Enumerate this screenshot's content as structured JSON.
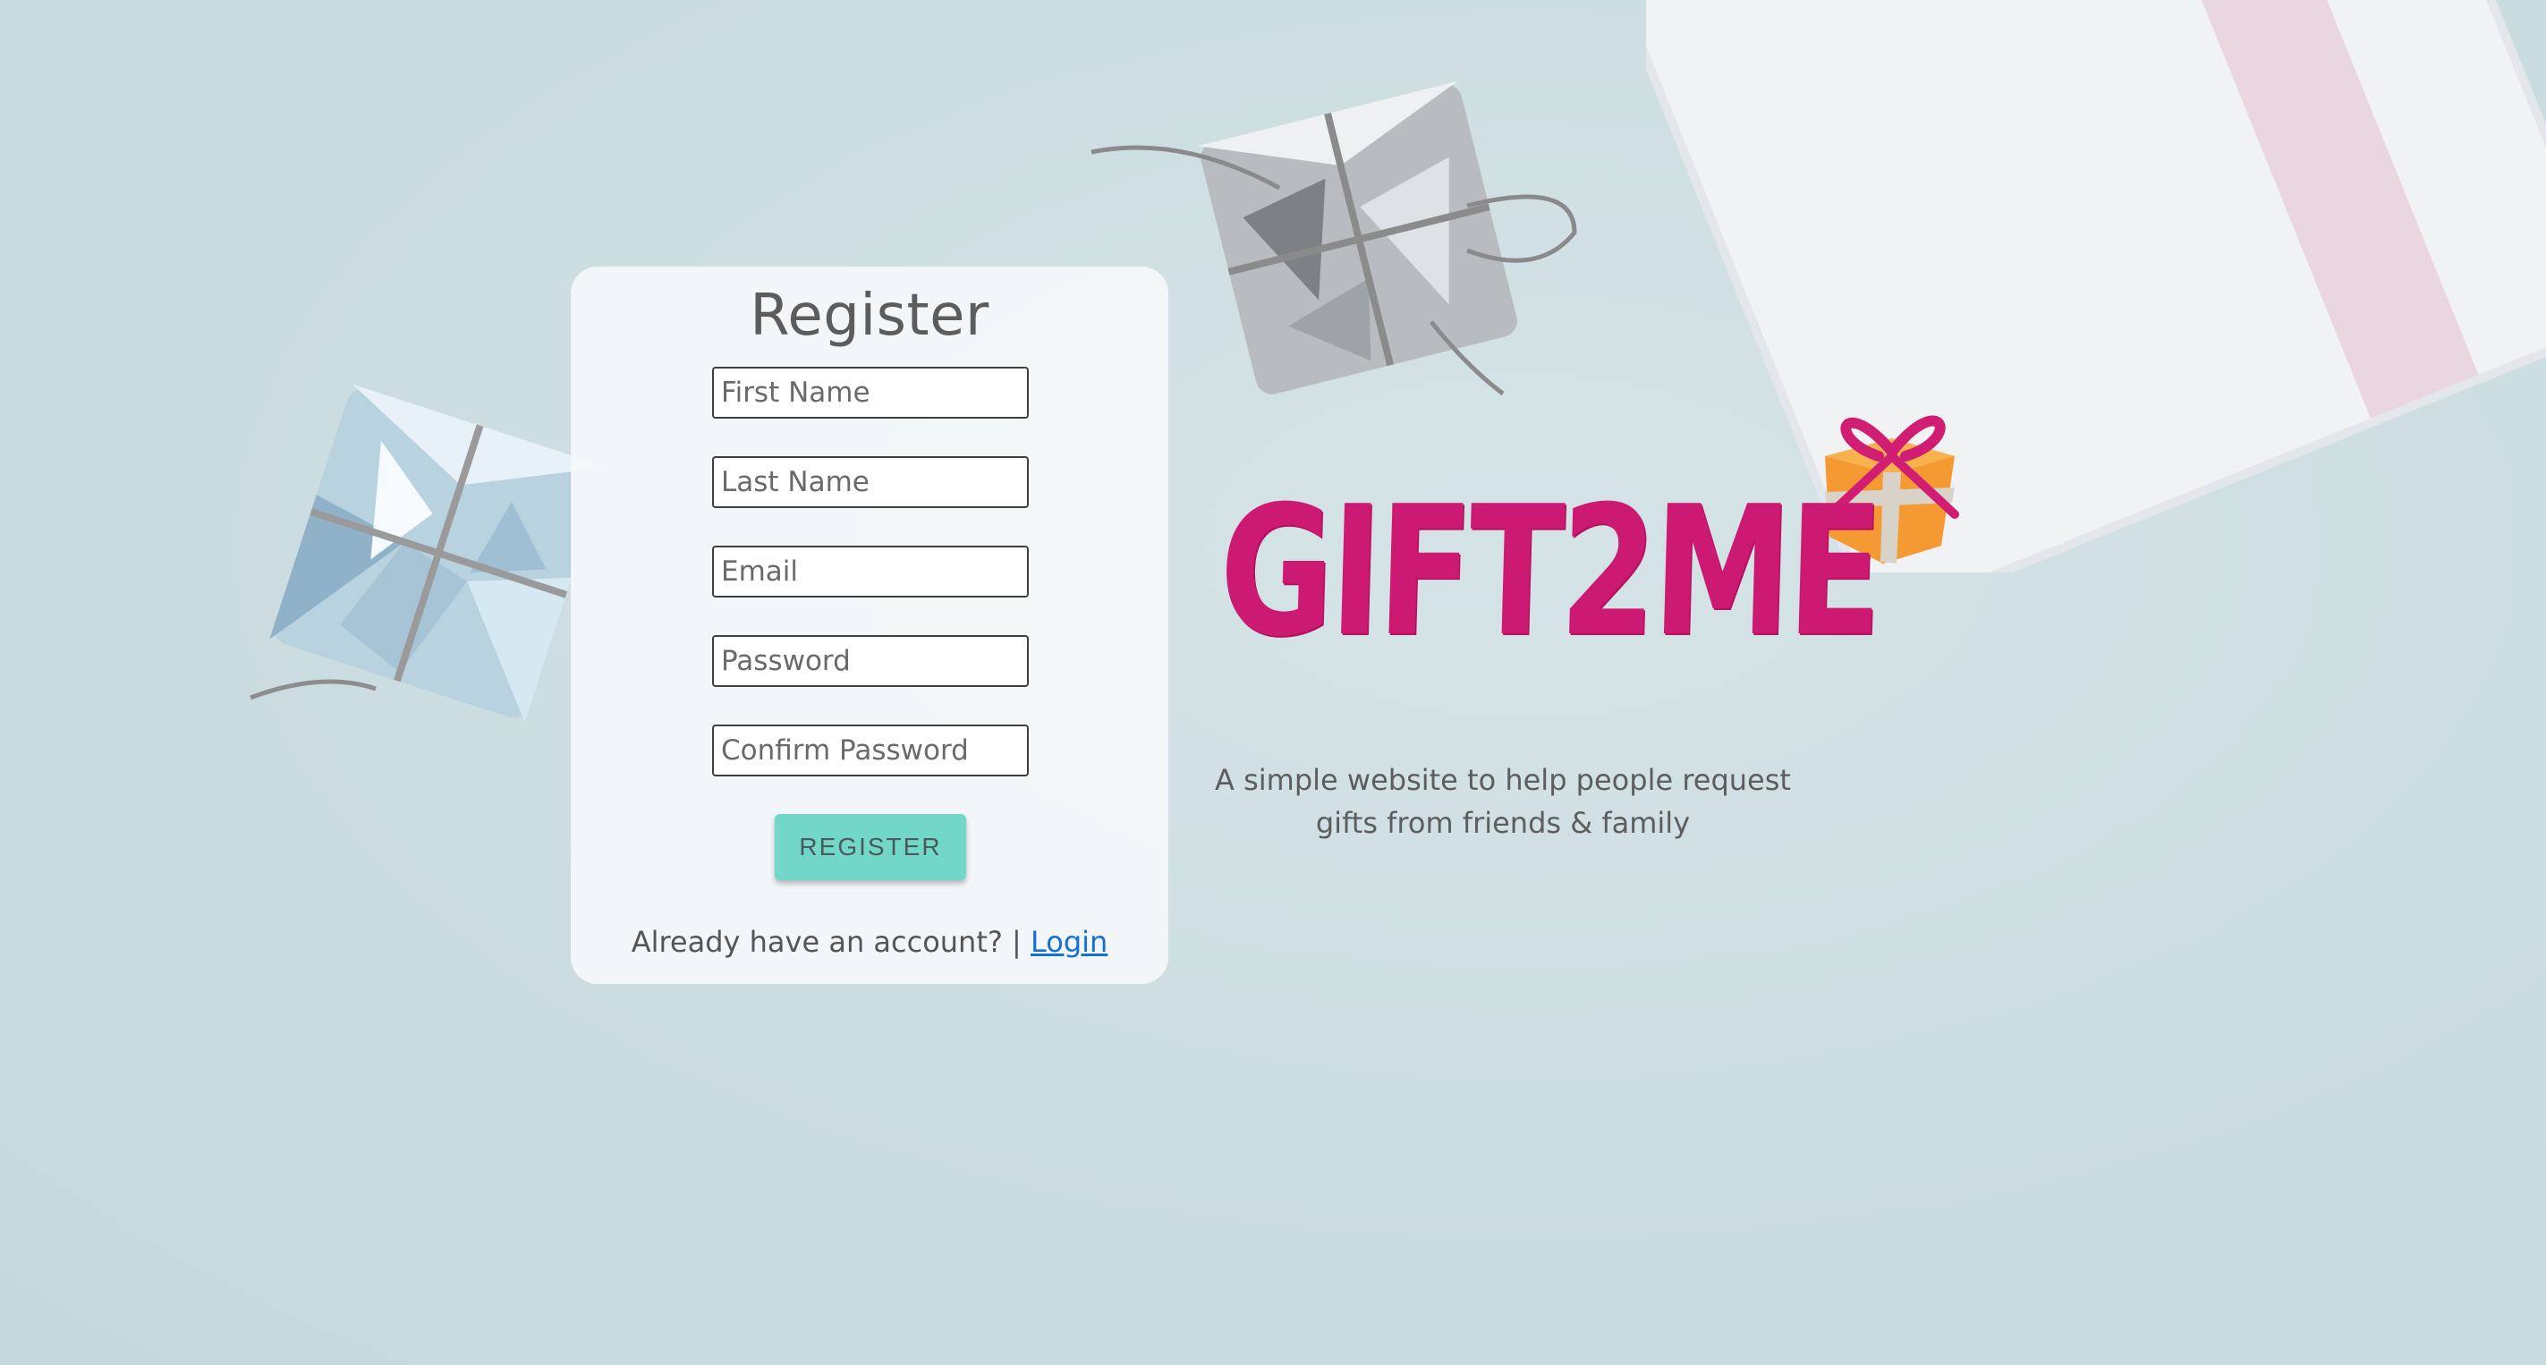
{
  "register": {
    "title": "Register",
    "first_name_placeholder": "First Name",
    "last_name_placeholder": "Last Name",
    "email_placeholder": "Email",
    "password_placeholder": "Password",
    "confirm_password_placeholder": "Confirm Password",
    "button_label": "REGISTER",
    "account_prompt": "Already have an account? | ",
    "login_label": "Login"
  },
  "brand": {
    "name": "GIFT2ME",
    "tagline_line1": "A simple website to help people request",
    "tagline_line2": "gifts from friends & family",
    "icon": "gift-box-icon"
  },
  "colors": {
    "background": "#ccdde1",
    "brand": "#cc1a72",
    "button": "#72d6c9",
    "link": "#1470d8"
  }
}
